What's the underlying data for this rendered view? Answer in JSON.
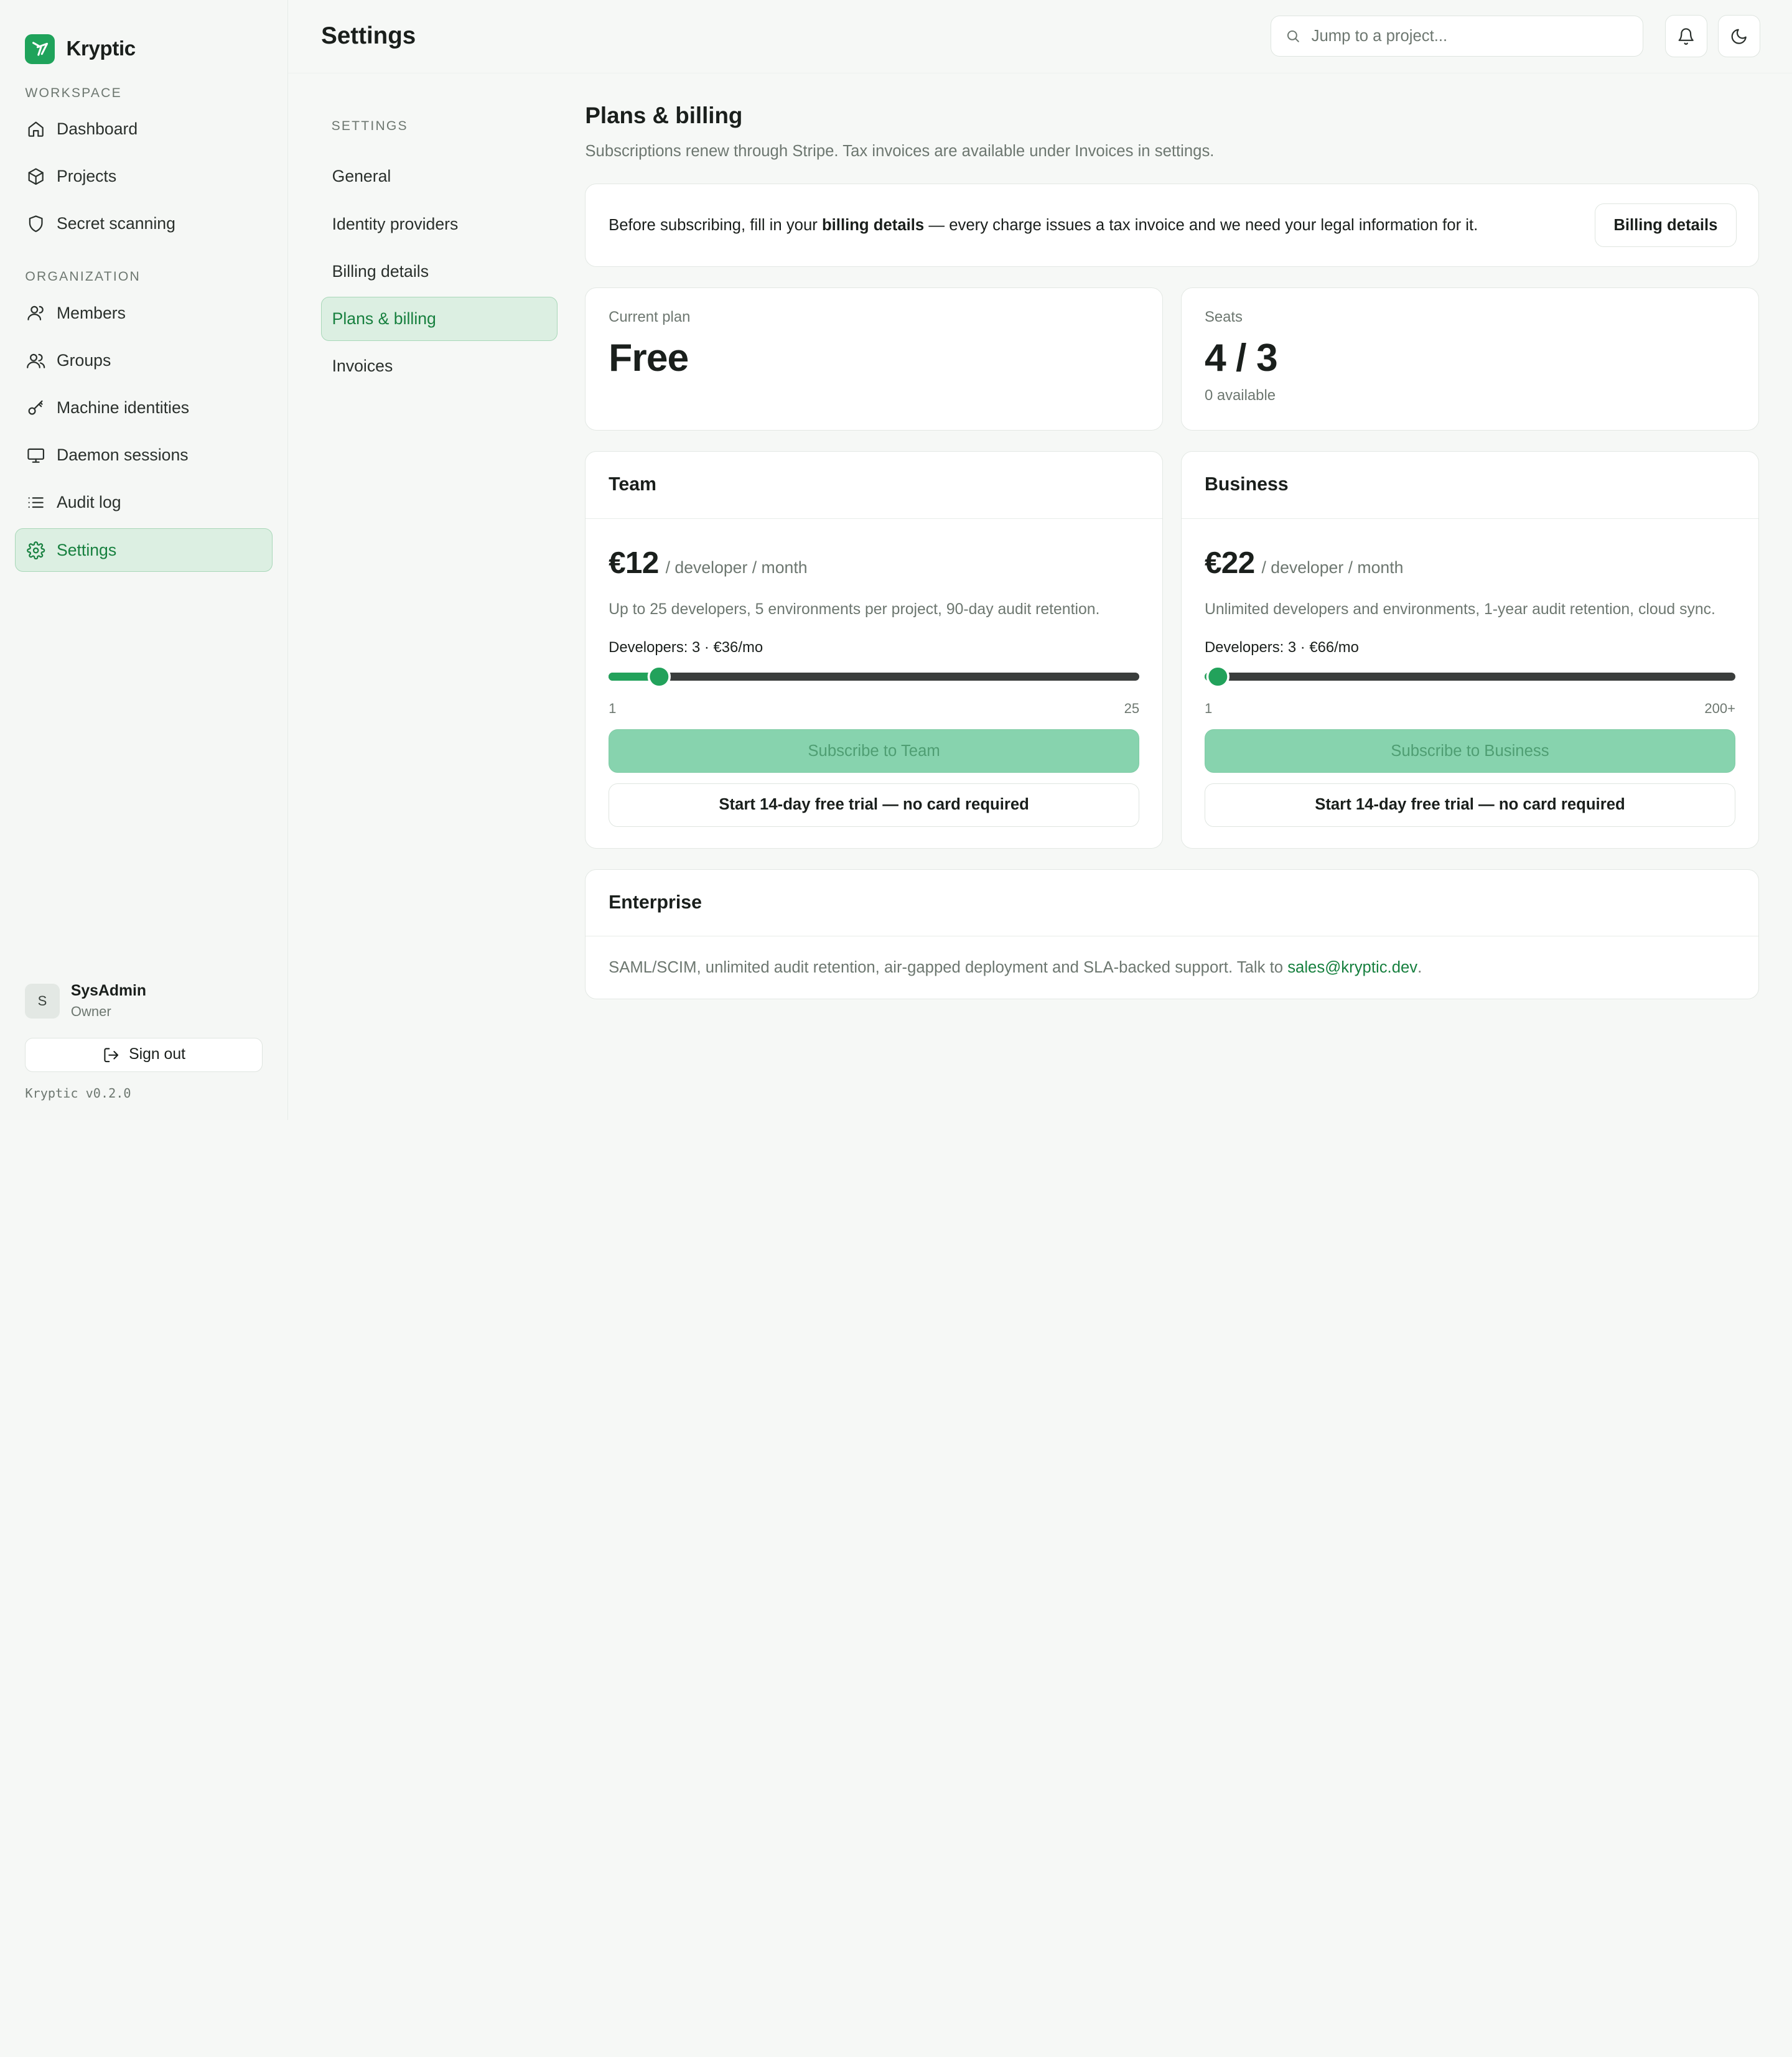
{
  "brand": {
    "name": "Kryptic"
  },
  "sidebar": {
    "sections": [
      {
        "title": "WORKSPACE",
        "items": [
          {
            "label": "Dashboard",
            "icon": "home-icon"
          },
          {
            "label": "Projects",
            "icon": "cube-icon"
          },
          {
            "label": "Secret scanning",
            "icon": "shield-icon"
          }
        ]
      },
      {
        "title": "ORGANIZATION",
        "items": [
          {
            "label": "Members",
            "icon": "user-icon"
          },
          {
            "label": "Groups",
            "icon": "users-icon"
          },
          {
            "label": "Machine identities",
            "icon": "key-icon"
          },
          {
            "label": "Daemon sessions",
            "icon": "monitor-icon"
          },
          {
            "label": "Audit log",
            "icon": "list-icon"
          },
          {
            "label": "Settings",
            "icon": "gear-icon",
            "active": true
          }
        ]
      }
    ],
    "user": {
      "initial": "S",
      "name": "SysAdmin",
      "role": "Owner"
    },
    "signout_label": "Sign out",
    "version": "Kryptic v0.2.0"
  },
  "header": {
    "title": "Settings",
    "search_placeholder": "Jump to a project..."
  },
  "settings_nav": {
    "title": "SETTINGS",
    "items": [
      "General",
      "Identity providers",
      "Billing details",
      "Plans & billing",
      "Invoices"
    ],
    "active_index": 3
  },
  "panel": {
    "title": "Plans & billing",
    "subtitle": "Subscriptions renew through Stripe. Tax invoices are available under Invoices in settings.",
    "notice": {
      "before": "Before subscribing, fill in your ",
      "bold": "billing details",
      "after": " — every charge issues a tax invoice and we need your legal information for it.",
      "button": "Billing details"
    },
    "current_plan": {
      "label": "Current plan",
      "value": "Free"
    },
    "seats": {
      "label": "Seats",
      "value": "4 / 3",
      "sub": "0 available"
    },
    "plans": [
      {
        "name": "Team",
        "price": "€12",
        "unit": "/ developer / month",
        "description": "Up to 25 developers, 5 environments per project, 90-day audit retention.",
        "developers_text": "Developers: 3 · €36/mo",
        "slider": {
          "min": 1,
          "max": 25,
          "value": 3,
          "min_label": "1",
          "max_label": "25"
        },
        "subscribe_label": "Subscribe to Team",
        "trial_label": "Start 14-day free trial — no card required"
      },
      {
        "name": "Business",
        "price": "€22",
        "unit": "/ developer / month",
        "description": "Unlimited developers and environments, 1-year audit retention, cloud sync.",
        "developers_text": "Developers: 3 · €66/mo",
        "slider": {
          "min": 1,
          "max": 200,
          "value": 3,
          "min_label": "1",
          "max_label": "200+"
        },
        "subscribe_label": "Subscribe to Business",
        "trial_label": "Start 14-day free trial — no card required"
      }
    ],
    "enterprise": {
      "name": "Enterprise",
      "text": "SAML/SCIM, unlimited audit retention, air-gapped deployment and SLA-backed support. Talk to ",
      "email": "sales@kryptic.dev",
      "suffix": "."
    }
  },
  "colors": {
    "accent": "#22a25b",
    "active_bg": "#dcefe2",
    "active_text": "#17803f"
  }
}
